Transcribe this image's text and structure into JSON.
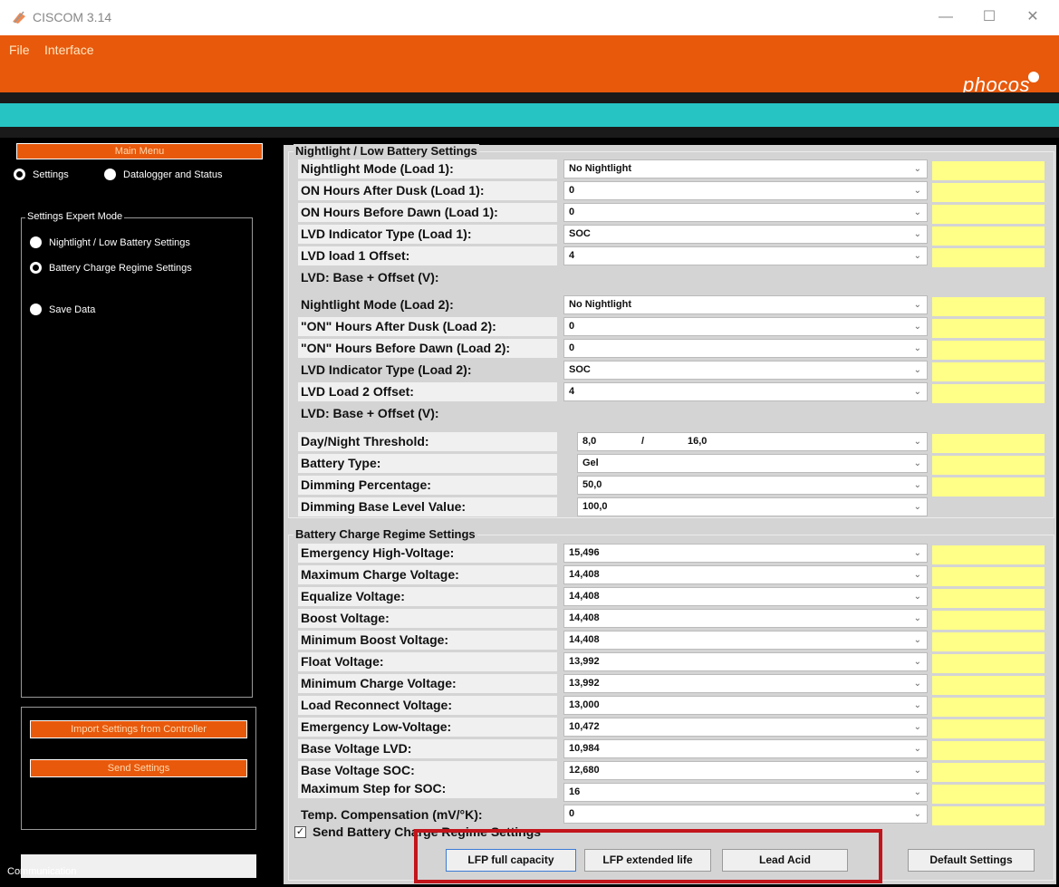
{
  "window": {
    "title": "CISCOM 3.14",
    "minimize": "—",
    "maximize": "☐",
    "close": "✕"
  },
  "menu": {
    "file": "File",
    "interface": "Interface",
    "logo": "phocos"
  },
  "sidebar": {
    "main_menu": "Main Menu",
    "settings": "Settings",
    "datalogger": "Datalogger and Status",
    "expert_group": "Settings Expert Mode",
    "nightlight_option": "Nightlight / Low Battery Settings",
    "charge_option": "Battery Charge Regime Settings",
    "save_data": "Save Data",
    "import_button": "Import Settings from Controller",
    "send_button": "Send Settings",
    "communication": "Communication"
  },
  "nightlight": {
    "title": "Nightlight / Low Battery Settings",
    "rows": [
      {
        "label": "Nightlight Mode (Load 1):",
        "value": "No Nightlight"
      },
      {
        "label": "ON Hours After Dusk  (Load 1):",
        "value": "0"
      },
      {
        "label": "ON Hours Before Dawn (Load 1):",
        "value": "0"
      },
      {
        "label": "LVD Indicator Type (Load 1):",
        "value": "SOC"
      },
      {
        "label": "LVD load 1 Offset:",
        "value": "4"
      },
      {
        "label": "LVD: Base + Offset (V):",
        "value": ""
      },
      {
        "label": "Nightlight Mode (Load 2):",
        "value": "No Nightlight"
      },
      {
        "label": "\"ON\" Hours After Dusk  (Load 2):",
        "value": "0"
      },
      {
        "label": "\"ON\" Hours Before Dawn (Load 2):",
        "value": "0"
      },
      {
        "label": "LVD Indicator Type (Load 2):",
        "value": "SOC"
      },
      {
        "label": "LVD Load 2 Offset:",
        "value": "4"
      },
      {
        "label": "LVD: Base + Offset (V):",
        "value": ""
      },
      {
        "label": "Day/Night Threshold:",
        "value": "8,0"
      },
      {
        "label": "Battery Type:",
        "value": "Gel"
      },
      {
        "label": "Dimming Percentage:",
        "value": "50,0"
      },
      {
        "label": "Dimming Base Level Value:",
        "value": "100,0"
      }
    ],
    "threshold_sep": "/",
    "threshold_second": "16,0"
  },
  "charge": {
    "title": "Battery Charge Regime Settings",
    "rows": [
      {
        "label": "Emergency High-Voltage:",
        "value": "15,496"
      },
      {
        "label": "Maximum Charge Voltage:",
        "value": "14,408"
      },
      {
        "label": "Equalize Voltage:",
        "value": "14,408"
      },
      {
        "label": "Boost Voltage:",
        "value": "14,408"
      },
      {
        "label": "Minimum Boost Voltage:",
        "value": "14,408"
      },
      {
        "label": "Float Voltage:",
        "value": "13,992"
      },
      {
        "label": "Minimum Charge Voltage:",
        "value": "13,992"
      },
      {
        "label": "Load Reconnect Voltage:",
        "value": "13,000"
      },
      {
        "label": "Emergency Low-Voltage:",
        "value": "10,472"
      },
      {
        "label": "Base Voltage LVD:",
        "value": "10,984"
      },
      {
        "label": "Base Voltage SOC:",
        "value": "12,680"
      },
      {
        "label": "Maximum Step for SOC:",
        "value": "16"
      },
      {
        "label": "Temp. Compensation (mV/°K):",
        "value": "0"
      }
    ],
    "send_checkbox": "Send Battery Charge Regime Settings",
    "check_mark": "✓"
  },
  "buttons": {
    "lfp_full": "LFP full capacity",
    "lfp_extended": "LFP extended life",
    "lead_acid": "Lead Acid",
    "default": "Default Settings"
  },
  "chevron": "⌄",
  "colors": {
    "accent": "#e8590c",
    "teal": "#27c4c4",
    "field_highlight": "#ffff88",
    "annotation_red": "#c2151b"
  }
}
